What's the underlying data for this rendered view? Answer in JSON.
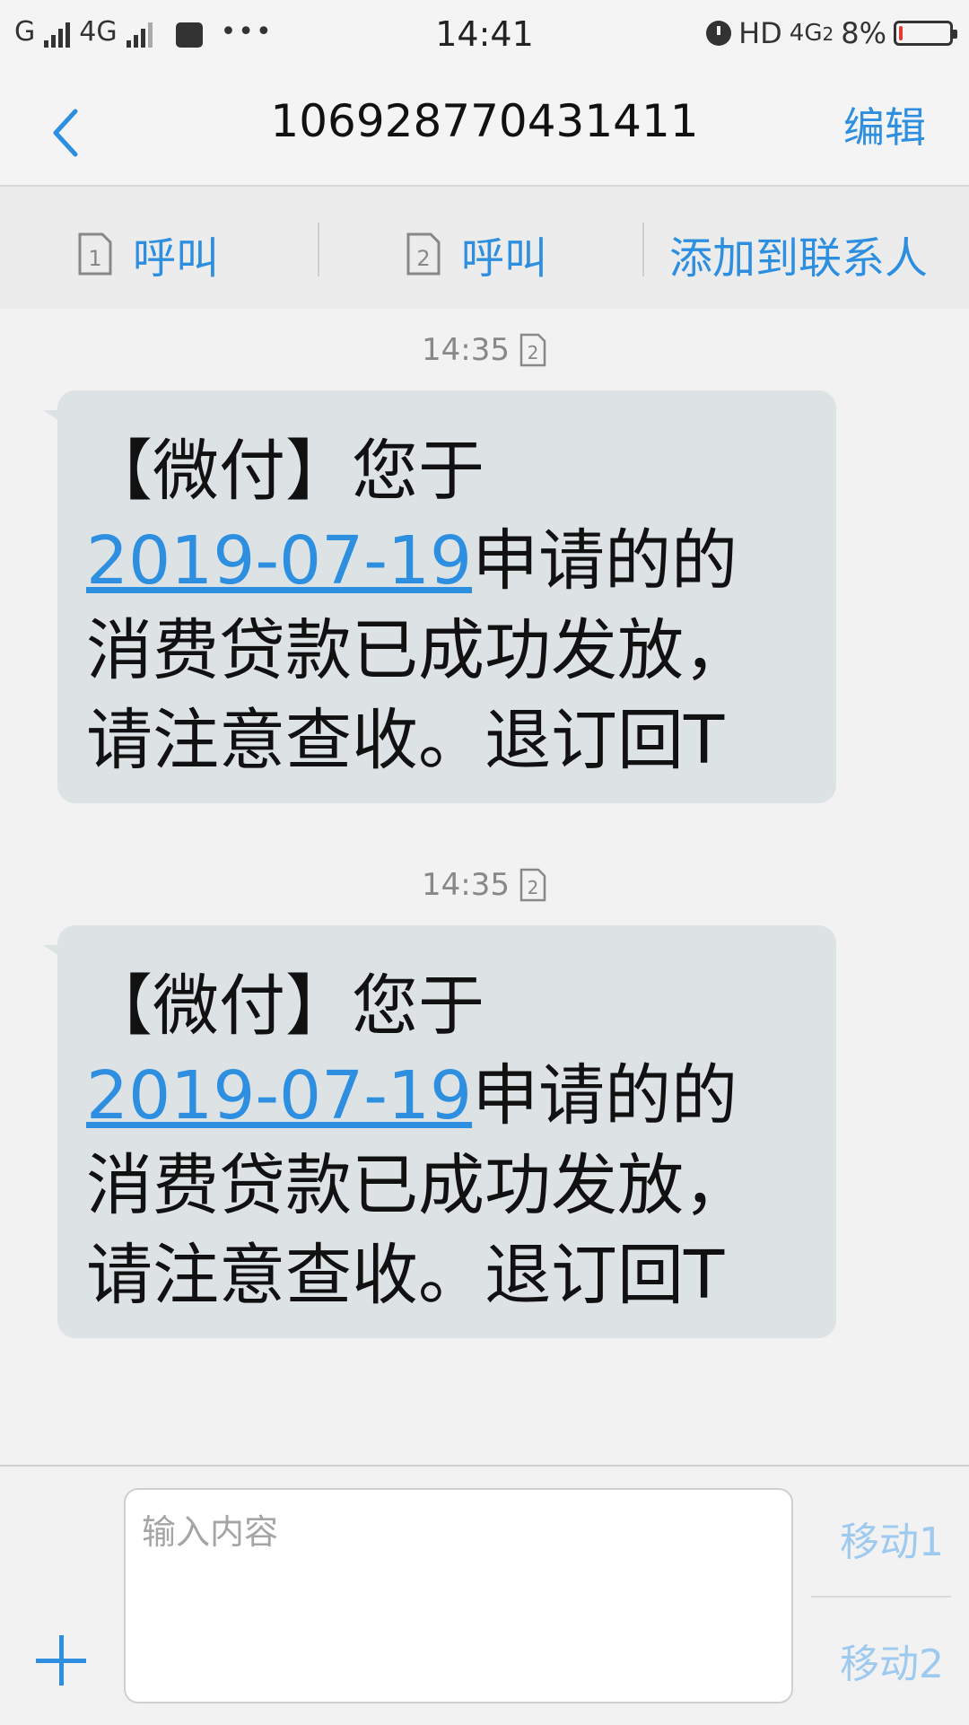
{
  "status_bar": {
    "carrier1": "G",
    "carrier2": "4G",
    "time": "14:41",
    "hd": "HD",
    "network": "4G",
    "sim_index": "2",
    "battery_text": "8%",
    "battery_level": 0.08
  },
  "header": {
    "title": "106928770431411",
    "edit_label": "编辑"
  },
  "actions": {
    "call1_sim": "1",
    "call1_label": "呼叫",
    "call2_sim": "2",
    "call2_label": "呼叫",
    "add_contact_label": "添加到联系人"
  },
  "messages": [
    {
      "time": "14:35",
      "sim": "2",
      "text_before": "【微付】您于",
      "date_link": "2019-07-19",
      "text_after": "申请的的消费贷款已成功发放，请注意查收。退订回T"
    },
    {
      "time": "14:35",
      "sim": "2",
      "text_before": "【微付】您于",
      "date_link": "2019-07-19",
      "text_after": "申请的的消费贷款已成功发放，请注意查收。退订回T"
    }
  ],
  "composer": {
    "placeholder": "输入内容",
    "send1_label": "移动1",
    "send2_label": "移动2"
  },
  "colors": {
    "accent": "#2e8fe0",
    "bubble": "#dde2e5",
    "battery_low": "#e53935"
  }
}
